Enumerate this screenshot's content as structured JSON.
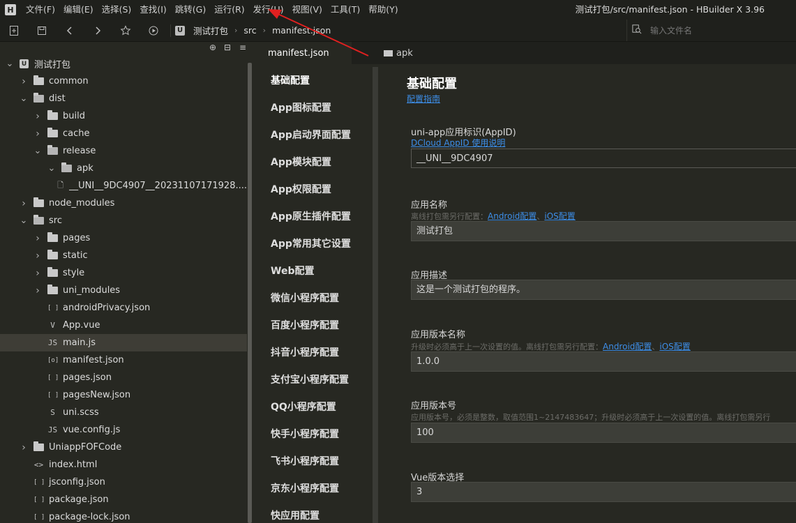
{
  "menubar": {
    "logo_letter": "H",
    "items": [
      "文件(F)",
      "编辑(E)",
      "选择(S)",
      "查找(I)",
      "跳转(G)",
      "运行(R)",
      "发行(U)",
      "视图(V)",
      "工具(T)",
      "帮助(Y)"
    ],
    "window_title": "测试打包/src/manifest.json - HBuilder X 3.96"
  },
  "toolbar": {
    "breadcrumb_badge": "U",
    "breadcrumb": [
      "测试打包",
      "src",
      "manifest.json"
    ],
    "file_search_placeholder": "输入文件名"
  },
  "sidebar": {
    "tree": [
      {
        "label": "测试打包",
        "type": "project",
        "depth": 0,
        "arrow": "open"
      },
      {
        "label": "common",
        "type": "folder",
        "depth": 1,
        "arrow": "closed"
      },
      {
        "label": "dist",
        "type": "folder",
        "depth": 1,
        "arrow": "open"
      },
      {
        "label": "build",
        "type": "folder",
        "depth": 2,
        "arrow": "closed"
      },
      {
        "label": "cache",
        "type": "folder",
        "depth": 2,
        "arrow": "closed"
      },
      {
        "label": "release",
        "type": "folder",
        "depth": 2,
        "arrow": "open"
      },
      {
        "label": "apk",
        "type": "folder",
        "depth": 3,
        "arrow": "open"
      },
      {
        "label": "__UNI__9DC4907__20231107171928....",
        "type": "file",
        "icon": "🗋",
        "depth": 4,
        "arrow": "none"
      },
      {
        "label": "node_modules",
        "type": "folder",
        "depth": 1,
        "arrow": "closed"
      },
      {
        "label": "src",
        "type": "folder",
        "depth": 1,
        "arrow": "open"
      },
      {
        "label": "pages",
        "type": "folder",
        "depth": 2,
        "arrow": "closed"
      },
      {
        "label": "static",
        "type": "folder",
        "depth": 2,
        "arrow": "closed"
      },
      {
        "label": "style",
        "type": "folder",
        "depth": 2,
        "arrow": "closed"
      },
      {
        "label": "uni_modules",
        "type": "folder",
        "depth": 2,
        "arrow": "closed"
      },
      {
        "label": "androidPrivacy.json",
        "type": "file",
        "icon": "[ ]",
        "depth": 2,
        "arrow": "none"
      },
      {
        "label": "App.vue",
        "type": "file",
        "icon": "V",
        "depth": 2,
        "arrow": "none"
      },
      {
        "label": "main.js",
        "type": "file",
        "icon": "JS",
        "depth": 2,
        "arrow": "none",
        "selected": true
      },
      {
        "label": "manifest.json",
        "type": "file",
        "icon": "[o]",
        "depth": 2,
        "arrow": "none"
      },
      {
        "label": "pages.json",
        "type": "file",
        "icon": "[ ]",
        "depth": 2,
        "arrow": "none"
      },
      {
        "label": "pagesNew.json",
        "type": "file",
        "icon": "[ ]",
        "depth": 2,
        "arrow": "none"
      },
      {
        "label": "uni.scss",
        "type": "file",
        "icon": "S",
        "depth": 2,
        "arrow": "none"
      },
      {
        "label": "vue.config.js",
        "type": "file",
        "icon": "JS",
        "depth": 2,
        "arrow": "none"
      },
      {
        "label": "UniappFOFCode",
        "type": "folder",
        "depth": 1,
        "arrow": "closed"
      },
      {
        "label": "index.html",
        "type": "file",
        "icon": "<>",
        "depth": 1,
        "arrow": "none"
      },
      {
        "label": "jsconfig.json",
        "type": "file",
        "icon": "[ ]",
        "depth": 1,
        "arrow": "none"
      },
      {
        "label": "package.json",
        "type": "file",
        "icon": "[ ]",
        "depth": 1,
        "arrow": "none"
      },
      {
        "label": "package-lock.json",
        "type": "file",
        "icon": "[ ]",
        "depth": 1,
        "arrow": "none"
      }
    ]
  },
  "tabs": [
    {
      "label": "manifest.json",
      "active": true
    },
    {
      "label": "apk",
      "active": false
    }
  ],
  "config_nav": [
    "基础配置",
    "App图标配置",
    "App启动界面配置",
    "App模块配置",
    "App权限配置",
    "App原生插件配置",
    "App常用其它设置",
    "Web配置",
    "微信小程序配置",
    "百度小程序配置",
    "抖音小程序配置",
    "支付宝小程序配置",
    "QQ小程序配置",
    "快手小程序配置",
    "飞书小程序配置",
    "京东小程序配置",
    "快应用配置"
  ],
  "form": {
    "title": "基础配置",
    "guide_link": "配置指南",
    "appid": {
      "label": "uni-app应用标识(AppID)",
      "help_link": "DCloud AppID 使用说明",
      "value": "__UNI__9DC4907"
    },
    "app_name": {
      "label": "应用名称",
      "hint_prefix": "离线打包需另行配置：",
      "android_link": "Android配置",
      "sep": "、",
      "ios_link": "iOS配置",
      "value": "测试打包"
    },
    "app_desc": {
      "label": "应用描述",
      "value": "这是一个测试打包的程序。"
    },
    "version_name": {
      "label": "应用版本名称",
      "hint_prefix": "升级时必须高于上一次设置的值。离线打包需另行配置：",
      "android_link": "Android配置",
      "sep": "、",
      "ios_link": "iOS配置",
      "value": "1.0.0"
    },
    "version_code": {
      "label": "应用版本号",
      "hint": "应用版本号，必须是整数，取值范围1~2147483647；升级时必须高于上一次设置的值。离线打包需另行",
      "value": "100"
    },
    "vue_version": {
      "label": "Vue版本选择",
      "value": "3"
    }
  }
}
